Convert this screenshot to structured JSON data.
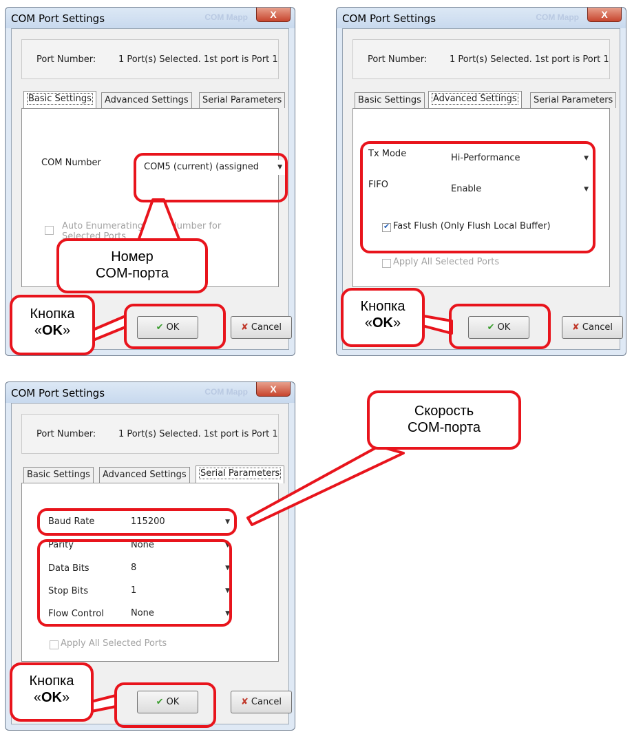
{
  "dialog_title": "COM Port Settings",
  "ghost_text": "COM Mapp",
  "close_glyph": "X",
  "port_number_label": "Port Number:",
  "port_number_value": "1 Port(s) Selected. 1st port is Port 1",
  "tabs": [
    "Basic Settings",
    "Advanced Settings",
    "Serial Parameters"
  ],
  "buttons": {
    "ok": "OK",
    "cancel": "Cancel"
  },
  "basic": {
    "com_number_label": "COM Number",
    "com_number_value": "COM5 (current) (assigned",
    "auto_enum_line1": "Auto Enumerating COM Number for",
    "auto_enum_line2": "Selected Ports"
  },
  "advanced": {
    "tx_mode_label": "Tx Mode",
    "tx_mode_value": "Hi-Performance",
    "fifo_label": "FIFO",
    "fifo_value": "Enable",
    "fast_flush_label": "Fast Flush (Only Flush Local Buffer)",
    "fast_flush_checked": true,
    "apply_all": "Apply All Selected Ports"
  },
  "serial": {
    "baud_label": "Baud Rate",
    "baud_value": "115200",
    "parity_label": "Parity",
    "parity_value": "None",
    "data_bits_label": "Data Bits",
    "data_bits_value": "8",
    "stop_bits_label": "Stop Bits",
    "stop_bits_value": "1",
    "flow_label": "Flow Control",
    "flow_value": "None",
    "apply_all": "Apply All Selected Ports"
  },
  "annotations": {
    "com_number_line1": "Номер",
    "com_number_line2": "COM-порта",
    "ok_line1": "Кнопка",
    "ok_line2_open": "«",
    "ok_line2_bold": "OK",
    "ok_line2_close": "»",
    "speed_line1": "Скорость",
    "speed_line2": "COM-порта"
  },
  "colors": {
    "annotation_red": "#e8141c",
    "check_green": "#3a9d2e",
    "cancel_red": "#c0392b"
  }
}
